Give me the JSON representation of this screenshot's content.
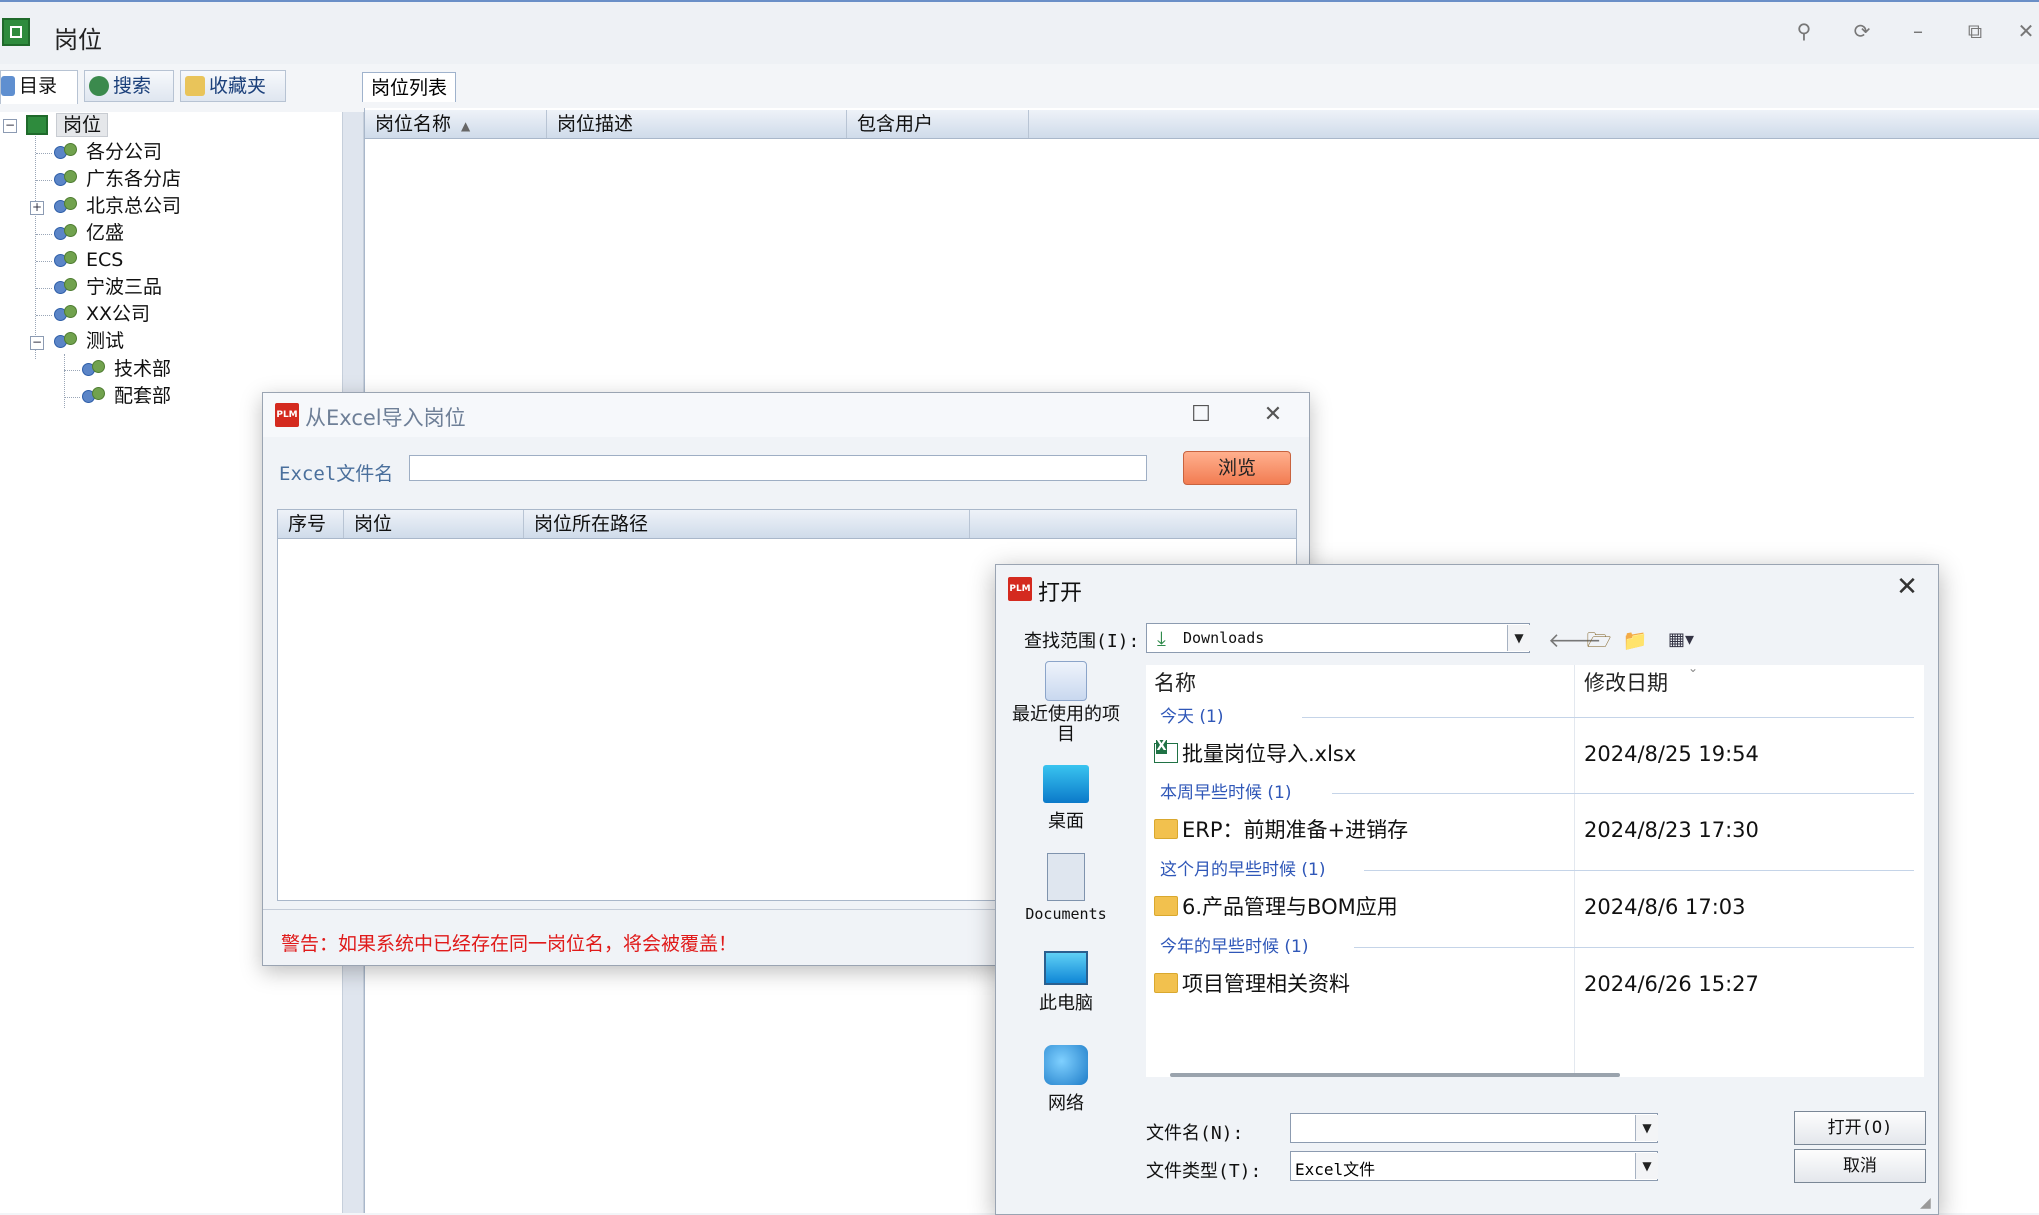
{
  "app": {
    "title": "岗位"
  },
  "window_controls": [
    "search-icon",
    "refresh-icon",
    "minimize-icon",
    "restore-icon",
    "close-icon"
  ],
  "nav_tabs": [
    {
      "label": "目录",
      "icon": "directory-icon"
    },
    {
      "label": "搜索",
      "icon": "search-globe-icon"
    },
    {
      "label": "收藏夹",
      "icon": "favorites-folder-icon"
    }
  ],
  "tree": {
    "root": "岗位",
    "children": [
      {
        "label": "各分公司"
      },
      {
        "label": "广东各分店"
      },
      {
        "label": "北京总公司",
        "expander": "+"
      },
      {
        "label": "亿盛"
      },
      {
        "label": "ECS"
      },
      {
        "label": "宁波三品"
      },
      {
        "label": "XX公司"
      },
      {
        "label": "测试",
        "expander": "−"
      }
    ],
    "sub_children": [
      {
        "label": "技术部"
      },
      {
        "label": "配套部"
      }
    ]
  },
  "right_panel": {
    "tab": "岗位列表",
    "columns": [
      "岗位名称",
      "岗位描述",
      "包含用户"
    ]
  },
  "import_dialog": {
    "title": "从Excel导入岗位",
    "file_label": "Excel文件名",
    "file_value": "",
    "browse": "浏览",
    "columns": [
      "序号",
      "岗位",
      "岗位所在路径"
    ],
    "warning": "警告：如果系统中已经存在同一岗位名，将会被覆盖！"
  },
  "open_dialog": {
    "title": "打开",
    "look_in_label": "查找范围(I):",
    "look_in_value": "Downloads",
    "places": [
      "最近使用的项目",
      "桌面",
      "Documents",
      "此电脑",
      "网络"
    ],
    "columns": {
      "name": "名称",
      "date": "修改日期"
    },
    "groups": [
      {
        "label": "今天 (1)",
        "files": [
          {
            "name": "批量岗位导入.xlsx",
            "date": "2024/8/25 19:54",
            "type": "xlsx"
          }
        ]
      },
      {
        "label": "本周早些时候 (1)",
        "files": [
          {
            "name": "ERP：前期准备+进销存",
            "date": "2024/8/23 17:30",
            "type": "folder"
          }
        ]
      },
      {
        "label": "这个月的早些时候 (1)",
        "files": [
          {
            "name": "6.产品管理与BOM应用",
            "date": "2024/8/6 17:03",
            "type": "folder"
          }
        ]
      },
      {
        "label": "今年的早些时候 (1)",
        "files": [
          {
            "name": "项目管理相关资料",
            "date": "2024/6/26 15:27",
            "type": "folder"
          }
        ]
      }
    ],
    "filename_label": "文件名(N):",
    "filename_value": "",
    "filetype_label": "文件类型(T):",
    "filetype_value": "Excel文件",
    "open_btn": "打开(O)",
    "cancel_btn": "取消"
  }
}
